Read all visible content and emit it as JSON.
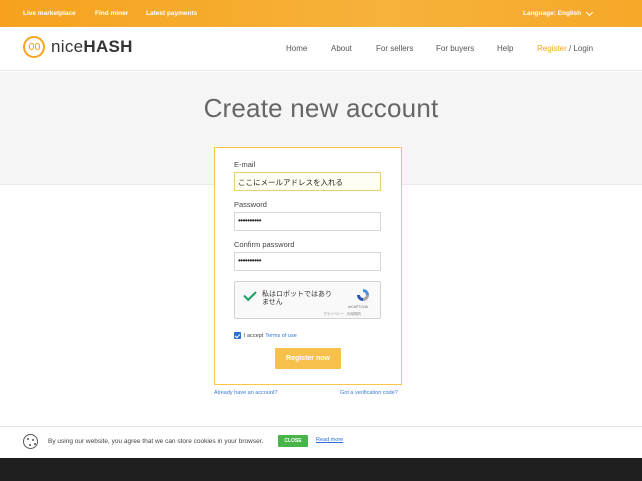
{
  "topbar": {
    "links": [
      "Live marketplace",
      "Find miner",
      "Latest payments"
    ],
    "language": "Language: English"
  },
  "header": {
    "logo_text_light": "nice",
    "logo_text_bold": "HASH",
    "nav": [
      "Home",
      "About",
      "For sellers",
      "For buyers",
      "Help"
    ],
    "register": "Register",
    "separator": " / ",
    "login": "Login"
  },
  "page": {
    "title": "Create new account"
  },
  "form": {
    "email_label": "E-mail",
    "email_value": "ここにメールアドレスを入れる",
    "password_label": "Password",
    "password_value": "••••••••••",
    "confirm_label": "Confirm password",
    "confirm_value": "••••••••••",
    "captcha_text": "私はロボットではありません",
    "captcha_brand": "reCAPTCHA",
    "captcha_privacy": "プライバシー - 利用規約",
    "terms_prefix": "I accept",
    "terms_link": "Terms of use",
    "register_button": "Register now"
  },
  "links": {
    "have_account": "Already have an account?",
    "verification": "Got a verification code?"
  },
  "cookie": {
    "text": "By using our website, you agree that we can store cookies in your browser.",
    "close": "CLOSE",
    "read_more": "Read more"
  },
  "colors": {
    "accent": "#f5a623",
    "close_green": "#48b54a",
    "link_blue": "#2a7ad6"
  }
}
